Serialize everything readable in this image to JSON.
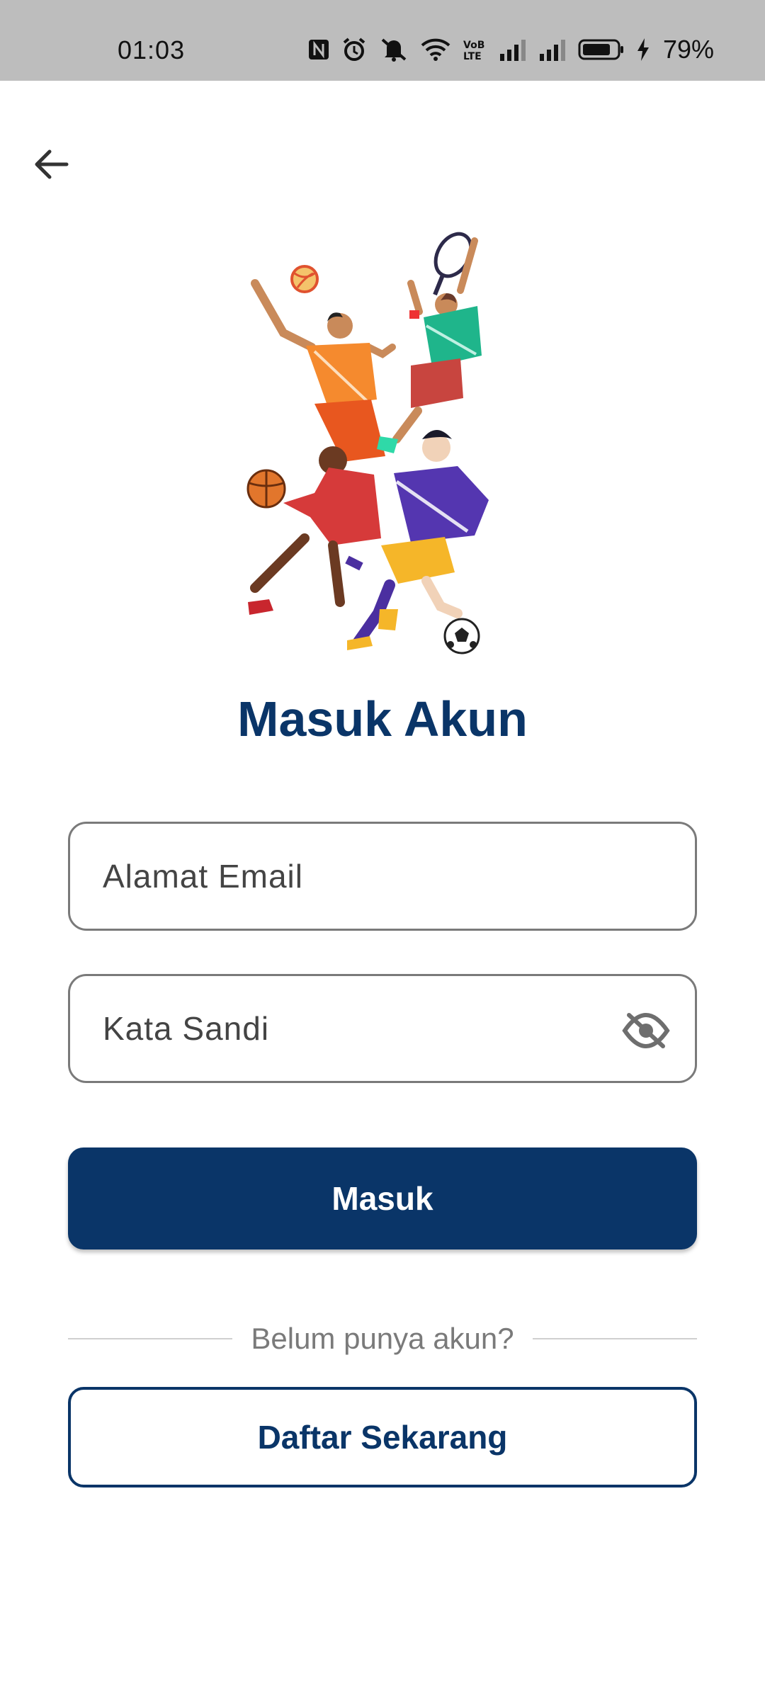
{
  "status_bar": {
    "time": "01:03",
    "battery_percent": "79%",
    "icons": [
      "nfc-icon",
      "alarm-icon",
      "mute-icon",
      "wifi-icon",
      "volte-icon",
      "signal-icon",
      "signal-icon",
      "battery-icon",
      "charging-icon"
    ]
  },
  "header": {
    "back_icon": "arrow-left-icon"
  },
  "illustration": {
    "icon": "sports-players-illustration"
  },
  "title": "Masuk Akun",
  "form": {
    "email_placeholder": "Alamat Email",
    "email_value": "",
    "password_placeholder": "Kata Sandi",
    "password_value": "",
    "visibility_icon": "eye-off-icon",
    "submit_label": "Masuk"
  },
  "divider_text": "Belum punya akun?",
  "register_label": "Daftar Sekarang",
  "colors": {
    "primary": "#0a3568",
    "status_bar_bg": "#bdbdbd",
    "field_border": "#7a7a7a",
    "muted_text": "#7a7a7a"
  }
}
